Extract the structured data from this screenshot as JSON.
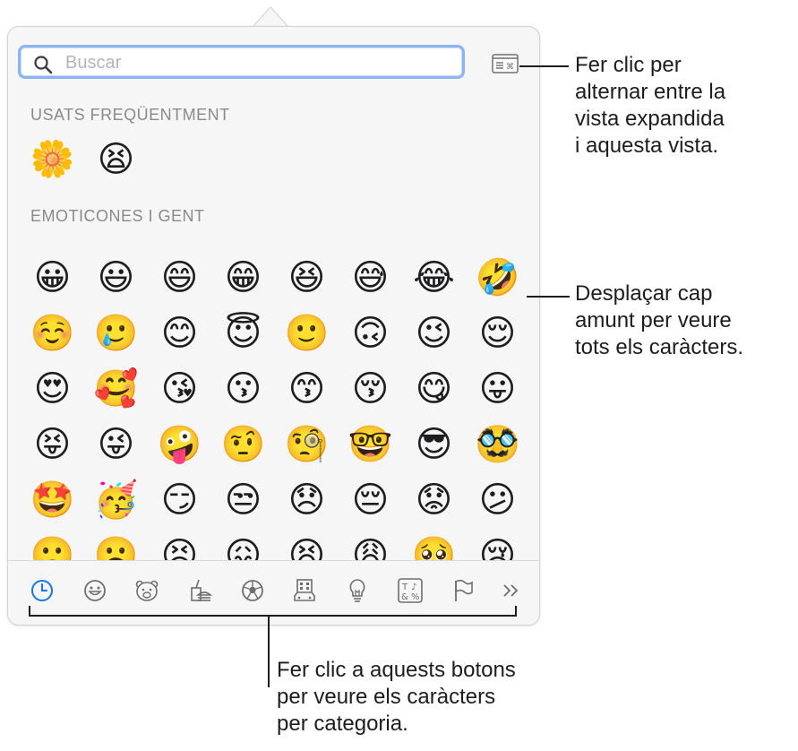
{
  "search": {
    "placeholder": "Buscar",
    "value": ""
  },
  "sections": {
    "frequent": {
      "title": "USATS FREQÜENTMENT",
      "emojis": [
        "🌼",
        "😫"
      ]
    },
    "people": {
      "title": "EMOTICONES I GENT",
      "rows": [
        [
          "😀",
          "😃",
          "😄",
          "😁",
          "😆",
          "😅",
          "😂",
          "🤣"
        ],
        [
          "☺️",
          "🥲",
          "😊",
          "😇",
          "🙂",
          "🙃",
          "😉",
          "😌"
        ],
        [
          "😍",
          "🥰",
          "😘",
          "😗",
          "😙",
          "😚",
          "😋",
          "😛"
        ],
        [
          "😝",
          "😜",
          "🤪",
          "🤨",
          "🧐",
          "🤓",
          "😎",
          "🥸"
        ],
        [
          "🤩",
          "🥳",
          "😏",
          "😒",
          "😞",
          "😔",
          "😟",
          "😕"
        ],
        [
          "🙁",
          "☹️",
          "😣",
          "😖",
          "😫",
          "😩",
          "🥺",
          "😢"
        ]
      ]
    }
  },
  "tabs": [
    {
      "icon": "clock-icon",
      "label": "Usats freqüentment",
      "active": true
    },
    {
      "icon": "smiley-icon",
      "label": "Emoticones i gent"
    },
    {
      "icon": "bear-icon",
      "label": "Animals i natura"
    },
    {
      "icon": "food-icon",
      "label": "Menjar i beguda"
    },
    {
      "icon": "soccer-ball-icon",
      "label": "Activitat"
    },
    {
      "icon": "building-car-icon",
      "label": "Viatges i llocs"
    },
    {
      "icon": "lightbulb-icon",
      "label": "Objectes"
    },
    {
      "icon": "symbols-icon",
      "label": "Símbols"
    },
    {
      "icon": "flag-icon",
      "label": "Banderes"
    },
    {
      "icon": "chevrons-right-icon",
      "label": "Més"
    }
  ],
  "callouts": {
    "toggle": "Fer clic per\nalternar entre la\nvista expandida\ni aquesta vista.",
    "scroll": "Desplaçar cap\namunt per veure\ntots els caràcters.",
    "tabs": "Fer clic a aquests botons\nper veure els caràcters\nper categoria."
  },
  "colors": {
    "accent": "#1a73e8",
    "focus_ring": "#8cb4f0",
    "icon_gray": "#6e6e6e"
  }
}
